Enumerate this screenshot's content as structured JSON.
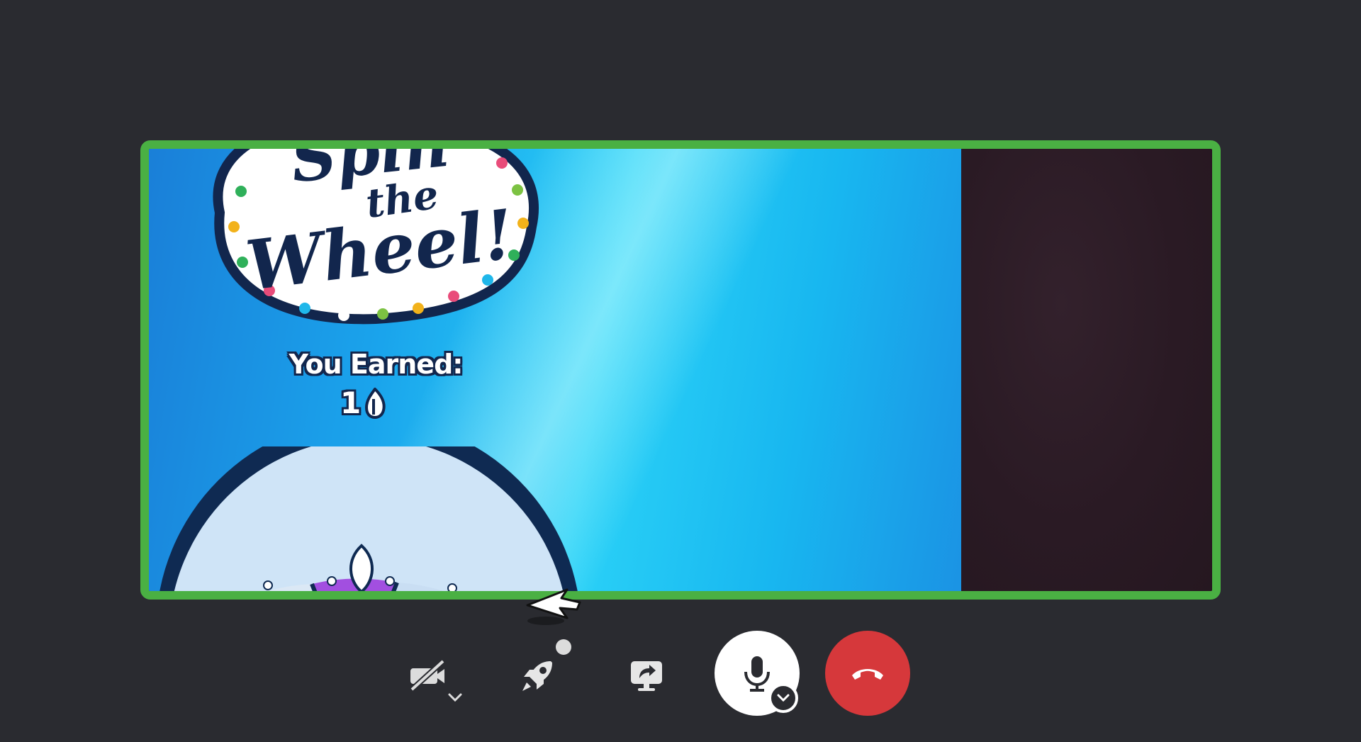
{
  "stream": {
    "game_title_line1": "Spin",
    "game_title_line2": "the",
    "game_title_line3": "Wheel!",
    "earned_label": "You Earned:",
    "earned_amount": "1",
    "currency_icon": "drop-icon"
  },
  "colors": {
    "speaking_border": "#4ab043",
    "leave_button": "#d6383b",
    "background": "#2a2b30"
  },
  "controls": {
    "camera": {
      "icon": "video-off-icon",
      "state": "off"
    },
    "activity": {
      "icon": "rocket-icon"
    },
    "screen_share": {
      "icon": "screen-share-icon"
    },
    "microphone": {
      "icon": "microphone-icon",
      "state": "on"
    },
    "leave": {
      "icon": "hang-up-icon"
    }
  }
}
